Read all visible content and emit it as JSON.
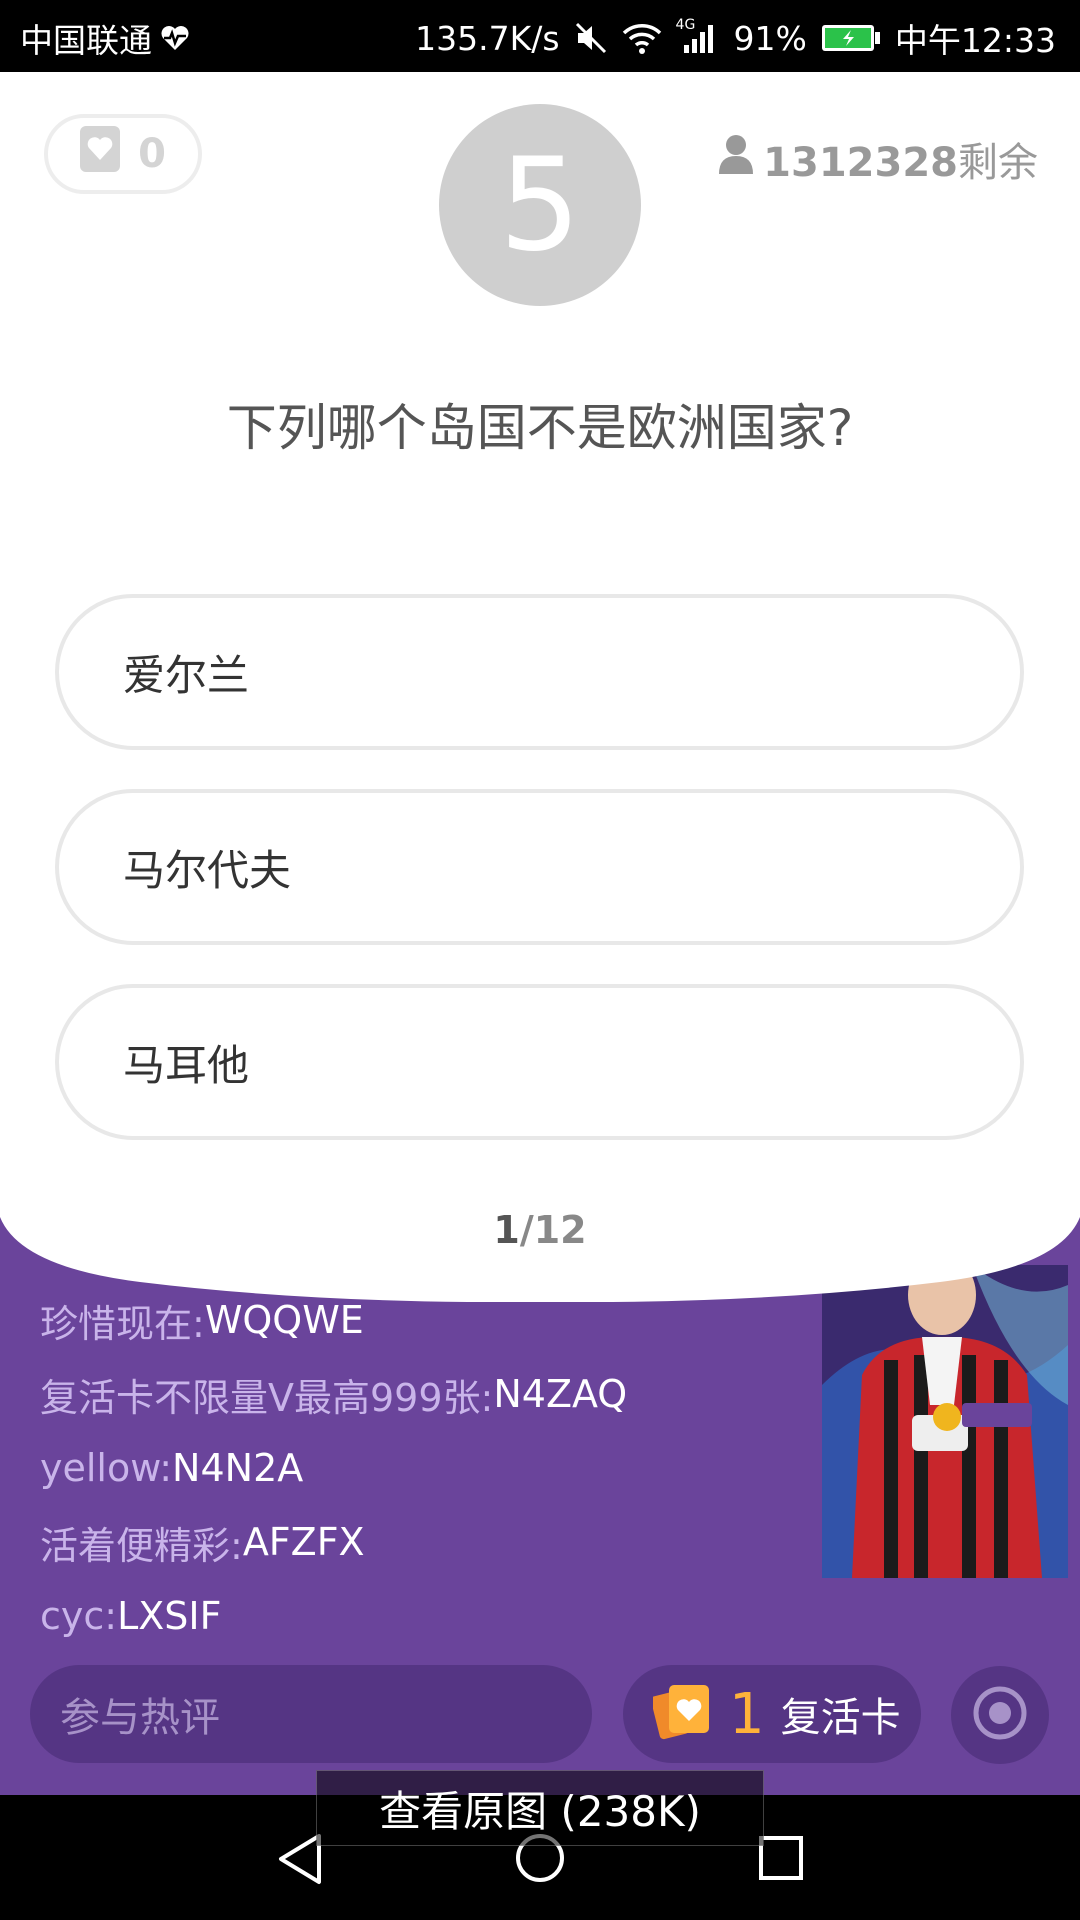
{
  "status_bar": {
    "carrier": "中国联通",
    "speed": "135.7K/s",
    "network": "4G",
    "battery": "91%",
    "time": "中午12:33"
  },
  "quiz": {
    "hearts": "0",
    "countdown": "5",
    "remaining_count": "1312328",
    "remaining_label": "剩余",
    "question": "下列哪个岛国不是欧洲国家?",
    "options": [
      {
        "label": "爱尔兰"
      },
      {
        "label": "马尔代夫"
      },
      {
        "label": "马耳他"
      }
    ],
    "progress_current": "1",
    "progress_total": "/12"
  },
  "comments": [
    {
      "user": "珍惜现在: ",
      "text": "WQQWE"
    },
    {
      "user": "复活卡不限量V最高999张: ",
      "text": "N4ZAQ"
    },
    {
      "user": "yellow: ",
      "text": "N4N2A"
    },
    {
      "user": "活着便精彩: ",
      "text": "AFZFX"
    },
    {
      "user": "cyc: ",
      "text": "LXSIF"
    }
  ],
  "bottom_bar": {
    "comment_placeholder": "参与热评",
    "revive_count": "1",
    "revive_label": "复活卡"
  },
  "overlay": {
    "view_original": "查看原图 (238K)"
  },
  "colors": {
    "purple_bg": "#6a449b",
    "pill_bg": "#553584",
    "accent_orange": "#ffb23a",
    "countdown_circle": "#cfcfcf"
  },
  "icons": [
    "heart-pulse-icon",
    "mute-icon",
    "wifi-icon",
    "signal-icon",
    "battery-icon",
    "heart-card-icon",
    "person-icon",
    "revive-card-icon",
    "record-icon",
    "nav-back-icon",
    "nav-home-icon",
    "nav-recent-icon"
  ]
}
